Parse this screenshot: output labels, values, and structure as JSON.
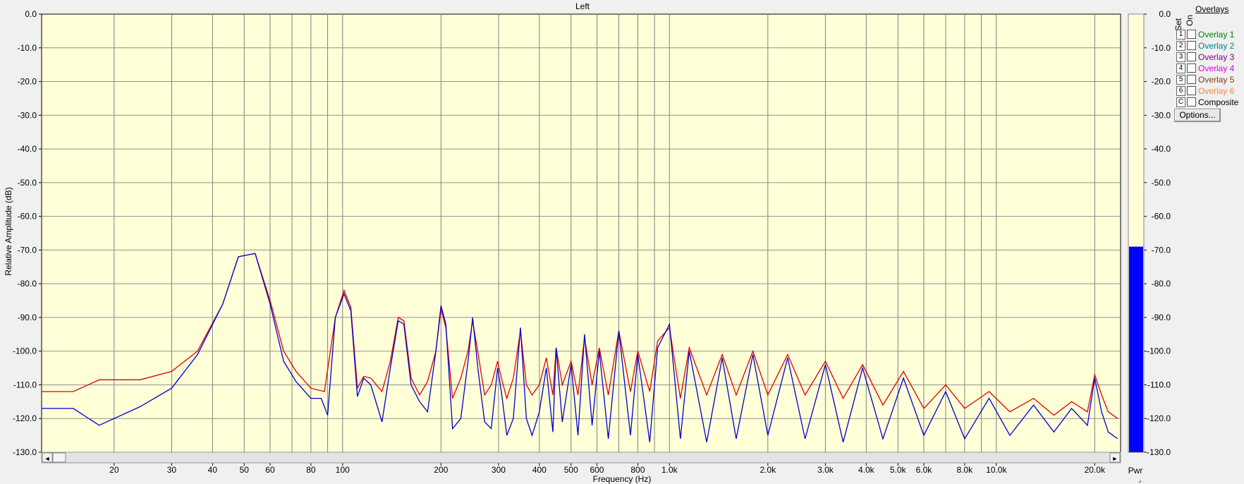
{
  "chart_data": {
    "type": "line",
    "title": "Left",
    "xlabel": "Frequency (Hz)",
    "ylabel": "Relative Amplitude (dB)",
    "x_scale": "log",
    "xlim": [
      12,
      24000
    ],
    "ylim": [
      -130,
      0
    ],
    "y_ticks": [
      "0.0",
      "-10.0",
      "-20.0",
      "-30.0",
      "-40.0",
      "-50.0",
      "-60.0",
      "-70.0",
      "-80.0",
      "-90.0",
      "-100.0",
      "-110.0",
      "-120.0",
      "-130.0"
    ],
    "x_tick_labels": [
      {
        "value": 20,
        "label": "20"
      },
      {
        "value": 30,
        "label": "30"
      },
      {
        "value": 40,
        "label": "40"
      },
      {
        "value": 50,
        "label": "50"
      },
      {
        "value": 60,
        "label": "60"
      },
      {
        "value": 80,
        "label": "80"
      },
      {
        "value": 100,
        "label": "100"
      },
      {
        "value": 200,
        "label": "200"
      },
      {
        "value": 300,
        "label": "300"
      },
      {
        "value": 400,
        "label": "400"
      },
      {
        "value": 500,
        "label": "500"
      },
      {
        "value": 600,
        "label": "600"
      },
      {
        "value": 800,
        "label": "800"
      },
      {
        "value": 1000,
        "label": "1.0k"
      },
      {
        "value": 2000,
        "label": "2.0k"
      },
      {
        "value": 3000,
        "label": "3.0k"
      },
      {
        "value": 4000,
        "label": "4.0k"
      },
      {
        "value": 5000,
        "label": "5.0k"
      },
      {
        "value": 6000,
        "label": "6.0k"
      },
      {
        "value": 8000,
        "label": "8.0k"
      },
      {
        "value": 10000,
        "label": "10.0k"
      },
      {
        "value": 20000,
        "label": "20.0k"
      }
    ],
    "grid": true,
    "series": [
      {
        "color": "#e00000",
        "points": [
          [
            12,
            -112
          ],
          [
            15,
            -112
          ],
          [
            18,
            -108.5
          ],
          [
            24,
            -108.5
          ],
          [
            30,
            -106
          ],
          [
            36,
            -100
          ],
          [
            43,
            -86
          ],
          [
            48,
            -72
          ],
          [
            54,
            -71
          ],
          [
            60,
            -85
          ],
          [
            66,
            -100
          ],
          [
            72,
            -106
          ],
          [
            80,
            -111
          ],
          [
            88,
            -112
          ],
          [
            95,
            -90
          ],
          [
            101,
            -82
          ],
          [
            106,
            -87
          ],
          [
            111,
            -111
          ],
          [
            116,
            -107.5
          ],
          [
            122,
            -108
          ],
          [
            132,
            -112
          ],
          [
            140,
            -103
          ],
          [
            148,
            -90
          ],
          [
            154,
            -91
          ],
          [
            162,
            -108
          ],
          [
            172,
            -113
          ],
          [
            182,
            -109
          ],
          [
            193,
            -100
          ],
          [
            200,
            -87.5
          ],
          [
            207,
            -93
          ],
          [
            217,
            -114
          ],
          [
            230,
            -108
          ],
          [
            242,
            -100
          ],
          [
            250,
            -91
          ],
          [
            260,
            -101
          ],
          [
            272,
            -113
          ],
          [
            285,
            -110
          ],
          [
            298,
            -103
          ],
          [
            306,
            -108
          ],
          [
            318,
            -114
          ],
          [
            333,
            -108
          ],
          [
            350,
            -94
          ],
          [
            365,
            -110
          ],
          [
            380,
            -113
          ],
          [
            400,
            -110
          ],
          [
            420,
            -102
          ],
          [
            440,
            -113
          ],
          [
            450,
            -99
          ],
          [
            470,
            -110
          ],
          [
            500,
            -103
          ],
          [
            525,
            -113
          ],
          [
            550,
            -96
          ],
          [
            580,
            -110
          ],
          [
            610,
            -99
          ],
          [
            650,
            -113
          ],
          [
            700,
            -94
          ],
          [
            760,
            -112
          ],
          [
            800,
            -100
          ],
          [
            870,
            -112
          ],
          [
            920,
            -97
          ],
          [
            1000,
            -93
          ],
          [
            1080,
            -114
          ],
          [
            1150,
            -99
          ],
          [
            1300,
            -113
          ],
          [
            1450,
            -101
          ],
          [
            1600,
            -113
          ],
          [
            1800,
            -100
          ],
          [
            2000,
            -113
          ],
          [
            2300,
            -101
          ],
          [
            2600,
            -113
          ],
          [
            3000,
            -103
          ],
          [
            3400,
            -114
          ],
          [
            3900,
            -104
          ],
          [
            4500,
            -116
          ],
          [
            5200,
            -106
          ],
          [
            6000,
            -117
          ],
          [
            7000,
            -110
          ],
          [
            8000,
            -117
          ],
          [
            9500,
            -112
          ],
          [
            11000,
            -118
          ],
          [
            13000,
            -114
          ],
          [
            15000,
            -119
          ],
          [
            17000,
            -115
          ],
          [
            19000,
            -118
          ],
          [
            20000,
            -107
          ],
          [
            21000,
            -113
          ],
          [
            22000,
            -118
          ],
          [
            23500,
            -120
          ]
        ]
      },
      {
        "color": "#0000d0",
        "points": [
          [
            12,
            -117
          ],
          [
            15,
            -117
          ],
          [
            18,
            -122
          ],
          [
            24,
            -116.5
          ],
          [
            30,
            -111
          ],
          [
            36,
            -101
          ],
          [
            43,
            -86
          ],
          [
            48,
            -72
          ],
          [
            54,
            -71
          ],
          [
            60,
            -86
          ],
          [
            66,
            -103
          ],
          [
            72,
            -109
          ],
          [
            80,
            -114
          ],
          [
            86,
            -114
          ],
          [
            90,
            -119
          ],
          [
            95,
            -90
          ],
          [
            101,
            -83
          ],
          [
            106,
            -88
          ],
          [
            111,
            -113.5
          ],
          [
            116,
            -108
          ],
          [
            122,
            -110
          ],
          [
            132,
            -121
          ],
          [
            140,
            -105
          ],
          [
            148,
            -91
          ],
          [
            154,
            -92
          ],
          [
            162,
            -110
          ],
          [
            172,
            -115
          ],
          [
            182,
            -118
          ],
          [
            193,
            -100
          ],
          [
            200,
            -86.5
          ],
          [
            207,
            -92
          ],
          [
            217,
            -123
          ],
          [
            230,
            -120
          ],
          [
            242,
            -103
          ],
          [
            250,
            -90
          ],
          [
            260,
            -106
          ],
          [
            272,
            -121
          ],
          [
            285,
            -123
          ],
          [
            298,
            -105
          ],
          [
            306,
            -112
          ],
          [
            318,
            -125
          ],
          [
            333,
            -120
          ],
          [
            350,
            -93
          ],
          [
            365,
            -120
          ],
          [
            380,
            -125
          ],
          [
            400,
            -118
          ],
          [
            420,
            -105
          ],
          [
            440,
            -124
          ],
          [
            450,
            -99
          ],
          [
            470,
            -121
          ],
          [
            500,
            -104
          ],
          [
            525,
            -125
          ],
          [
            550,
            -95
          ],
          [
            580,
            -122
          ],
          [
            610,
            -100
          ],
          [
            650,
            -126
          ],
          [
            700,
            -94
          ],
          [
            760,
            -125
          ],
          [
            800,
            -101
          ],
          [
            870,
            -127
          ],
          [
            920,
            -99
          ],
          [
            1000,
            -92
          ],
          [
            1080,
            -126
          ],
          [
            1150,
            -100
          ],
          [
            1300,
            -127
          ],
          [
            1450,
            -102
          ],
          [
            1600,
            -126
          ],
          [
            1800,
            -101
          ],
          [
            2000,
            -125
          ],
          [
            2300,
            -102
          ],
          [
            2600,
            -126
          ],
          [
            3000,
            -104
          ],
          [
            3400,
            -127
          ],
          [
            3900,
            -105
          ],
          [
            4500,
            -126
          ],
          [
            5200,
            -108
          ],
          [
            6000,
            -125
          ],
          [
            7000,
            -112
          ],
          [
            8000,
            -126
          ],
          [
            9500,
            -114
          ],
          [
            11000,
            -125
          ],
          [
            13000,
            -116
          ],
          [
            15000,
            -124
          ],
          [
            17000,
            -117
          ],
          [
            19000,
            -122
          ],
          [
            20000,
            -108
          ],
          [
            21000,
            -118
          ],
          [
            22000,
            -124
          ],
          [
            23500,
            -126
          ]
        ]
      }
    ]
  },
  "power_meter": {
    "label": "Pwr",
    "level_db": -69,
    "fill_color": "#0000ff"
  },
  "overlays": {
    "title": "Overlays",
    "set_header": "Set",
    "on_header": "On",
    "items": [
      {
        "num": "1",
        "label": "Overlay 1",
        "color": "#008000"
      },
      {
        "num": "2",
        "label": "Overlay 2",
        "color": "#008080"
      },
      {
        "num": "3",
        "label": "Overlay 3",
        "color": "#800080"
      },
      {
        "num": "4",
        "label": "Overlay 4",
        "color": "#e000e0"
      },
      {
        "num": "5",
        "label": "Overlay 5",
        "color": "#804000"
      },
      {
        "num": "6",
        "label": "Overlay 6",
        "color": "#ff8040"
      }
    ],
    "composite": {
      "num": "C",
      "label": "Composite"
    },
    "options_label": "Options..."
  },
  "scrollbar": {
    "left_arrow": "◄",
    "right_arrow": "►"
  }
}
